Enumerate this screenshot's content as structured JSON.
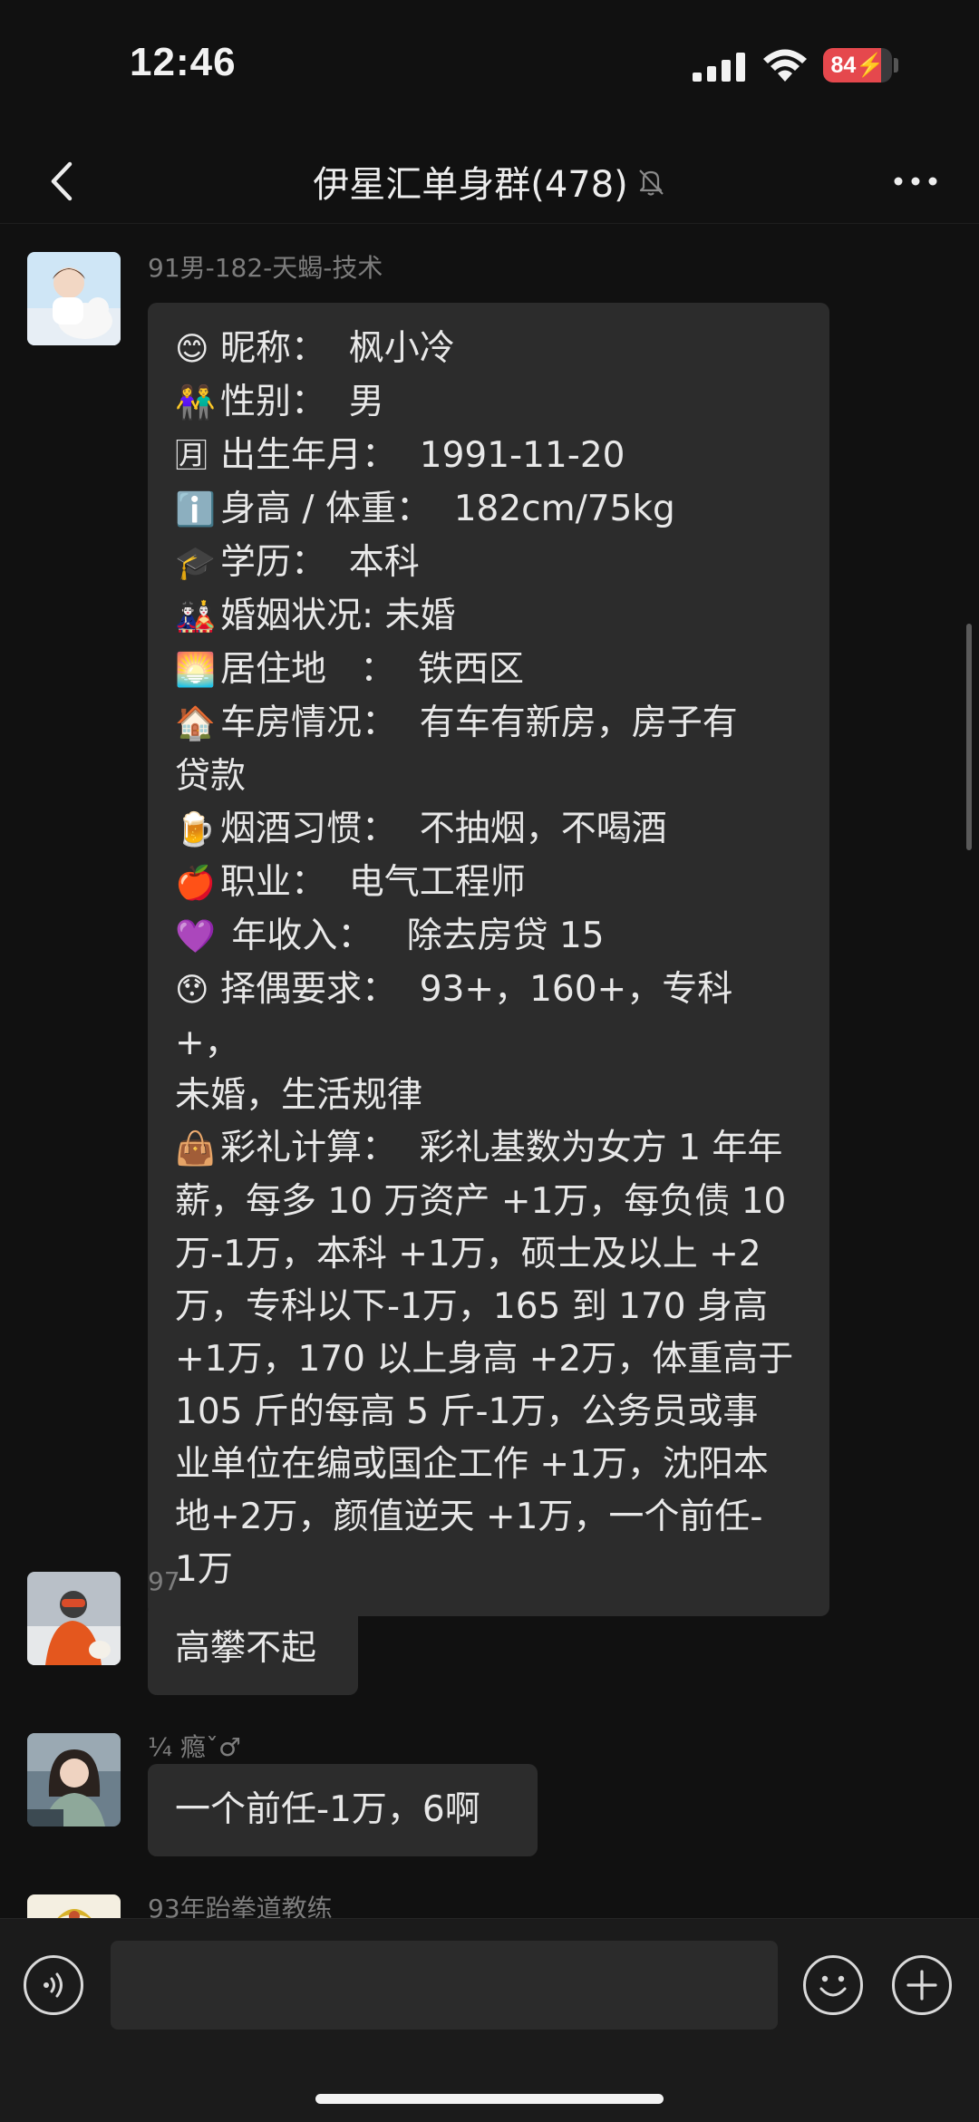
{
  "status_bar": {
    "time": "12:46",
    "battery_level": "84",
    "battery_level_fraction": 0.84,
    "battery_color": "#e5484d"
  },
  "nav": {
    "title": "伊星汇单身群(478)",
    "back_icon": "chevron-left-icon",
    "mute_icon": "bell-off-icon",
    "more_icon": "more-dots-icon"
  },
  "messages": [
    {
      "sender": "91男-182-天蝎-技术",
      "lines": [
        {
          "emoji": "😊",
          "text": "昵称：  枫小冷"
        },
        {
          "emoji": "👫",
          "text": "性别：  男"
        },
        {
          "emoji": "🈷",
          "text": "出生年月：  1991-11-20"
        },
        {
          "emoji": "ℹ️",
          "text": "身高 / 体重：  182cm/75kg"
        },
        {
          "emoji": "🎓",
          "text": "学历：  本科"
        },
        {
          "emoji": "🎎",
          "text": "婚姻状况: 未婚"
        },
        {
          "emoji": "🌅",
          "text": "居住地   ：  铁西区"
        },
        {
          "emoji": "🏠",
          "text": "车房情况：  有车有新房，房子有"
        },
        {
          "emoji": "",
          "text": "贷款"
        },
        {
          "emoji": "🍺",
          "text": "烟酒习惯：  不抽烟，不喝酒"
        },
        {
          "emoji": "🍎",
          "text": "职业：  电气工程师"
        },
        {
          "emoji": "💜",
          "text": " 年收入：   除去房贷 15"
        },
        {
          "emoji": "😯",
          "text": "择偶要求：  93+，160+，专科 +，"
        },
        {
          "emoji": "",
          "text": "未婚，生活规律"
        },
        {
          "emoji": "👜",
          "text": "彩礼计算：  彩礼基数为女方 1 年年"
        },
        {
          "emoji": "",
          "text": "薪，每多 10 万资产 +1万，每负债 10"
        },
        {
          "emoji": "",
          "text": "万-1万，本科 +1万，硕士及以上 +2"
        },
        {
          "emoji": "",
          "text": "万，专科以下-1万，165 到 170 身高"
        },
        {
          "emoji": "",
          "text": "+1万，170 以上身高 +2万，体重高于"
        },
        {
          "emoji": "",
          "text": "105 斤的每高 5 斤-1万，公务员或事"
        },
        {
          "emoji": "",
          "text": "业单位在编或国企工作 +1万，沈阳本"
        },
        {
          "emoji": "",
          "text": "地+2万，颜值逆天 +1万，一个前任-"
        },
        {
          "emoji": "",
          "text": "1万"
        }
      ]
    },
    {
      "sender": "97",
      "text": "高攀不起"
    },
    {
      "sender": "¼ 瘾ˇ♂︎",
      "text": "一个前任-1万，6啊"
    },
    {
      "sender": "93年跆拳道教练"
    }
  ],
  "input_bar": {
    "voice_icon": "voice-icon",
    "input_value": "",
    "emoji_icon": "smile-icon",
    "plus_icon": "plus-icon"
  }
}
